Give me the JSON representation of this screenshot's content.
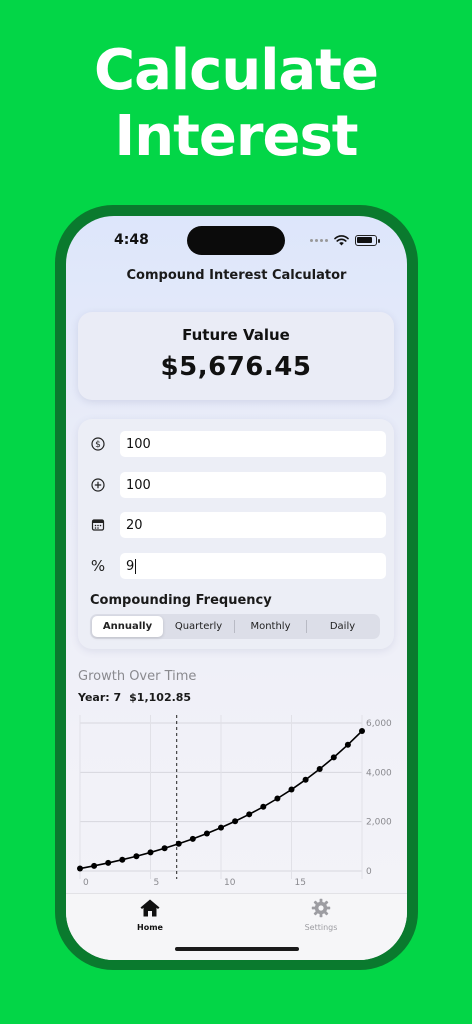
{
  "headline": {
    "line1": "Calculate",
    "line2": "Interest"
  },
  "status_bar": {
    "time": "4:48"
  },
  "nav": {
    "title": "Compound Interest Calculator"
  },
  "future_value": {
    "label": "Future Value",
    "value": "$5,676.45"
  },
  "inputs": {
    "principal": {
      "icon": "dollar-circle-icon",
      "value": "100"
    },
    "contribution": {
      "icon": "plus-circle-icon",
      "value": "100"
    },
    "years": {
      "icon": "calendar-icon",
      "value": "20"
    },
    "rate": {
      "icon": "percent-icon",
      "glyph": "%",
      "value": "9"
    }
  },
  "frequency": {
    "label": "Compounding Frequency",
    "options": [
      "Annually",
      "Quarterly",
      "Monthly",
      "Daily"
    ],
    "selected": "Annually"
  },
  "growth": {
    "title": "Growth Over Time",
    "selected_year": "Year: 7",
    "selected_value": "$1,102.85"
  },
  "chart_data": {
    "type": "line",
    "x": [
      0,
      1,
      2,
      3,
      4,
      5,
      6,
      7,
      8,
      9,
      10,
      11,
      12,
      13,
      14,
      15,
      16,
      17,
      18,
      19,
      20
    ],
    "values": [
      100,
      209,
      328,
      458,
      599,
      753,
      921,
      1104,
      1303,
      1521,
      1758,
      2016,
      2298,
      2604,
      2939,
      3303,
      3701,
      4134,
      4606,
      5120,
      5676
    ],
    "xticks": [
      "0",
      "5",
      "10",
      "15"
    ],
    "yticks": [
      "0",
      "2,000",
      "4,000",
      "6,000"
    ],
    "xlim": [
      0,
      20
    ],
    "ylim": [
      0,
      6000
    ],
    "grid": true,
    "marker_x": 7,
    "line_color": "#000000"
  },
  "tabbar": {
    "home": {
      "label": "Home",
      "icon": "house-icon"
    },
    "settings": {
      "label": "Settings",
      "icon": "gear-icon"
    }
  },
  "colors": {
    "background": "#03d647",
    "phone_frame": "#0a7a2e",
    "selected_tab": "#111111",
    "inactive_tab": "#9d9da2"
  }
}
